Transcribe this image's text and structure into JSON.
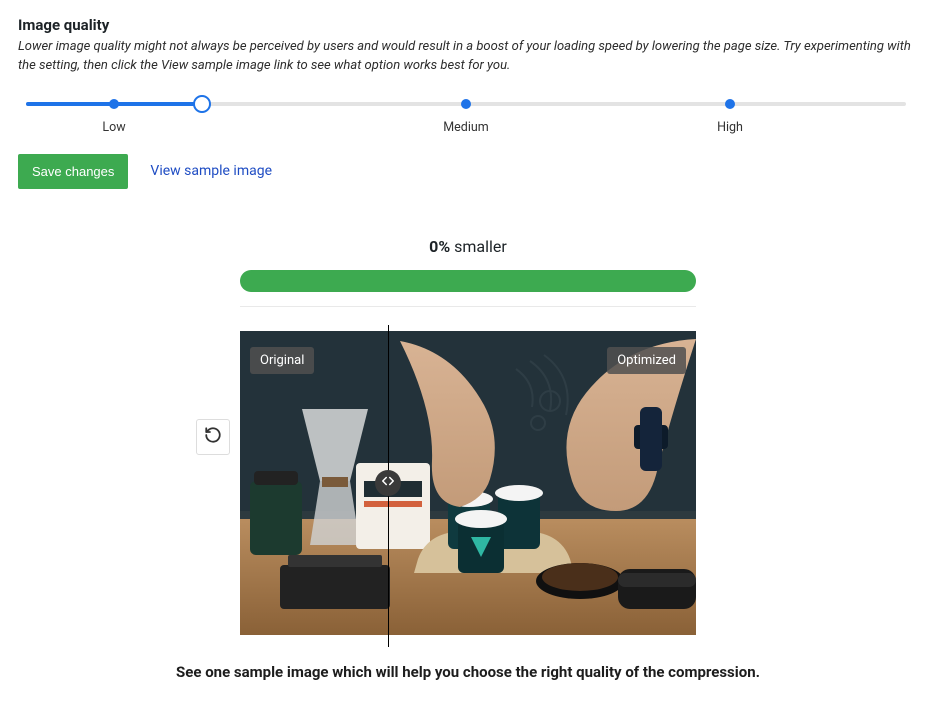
{
  "section": {
    "title": "Image quality",
    "description": "Lower image quality might not always be perceived by users and would result in a boost of your loading speed by lowering the page size. Try experimenting with the setting, then click the View sample image link to see what option works best for you."
  },
  "slider": {
    "labels": {
      "low": "Low",
      "medium": "Medium",
      "high": "High"
    },
    "selected_value": "Low",
    "handle_position_pct": 20,
    "stop_positions_pct": {
      "low": 10,
      "medium": 50,
      "high": 80
    }
  },
  "actions": {
    "save_label": "Save changes",
    "sample_link_label": "View sample image"
  },
  "result": {
    "percent_label": "0%",
    "smaller_label": " smaller"
  },
  "compare": {
    "badge_original": "Original",
    "badge_optimized": "Optimized",
    "divider_pct": 32.5
  },
  "footer": {
    "caption": "See one sample image which will help you choose the right quality of the compression."
  }
}
